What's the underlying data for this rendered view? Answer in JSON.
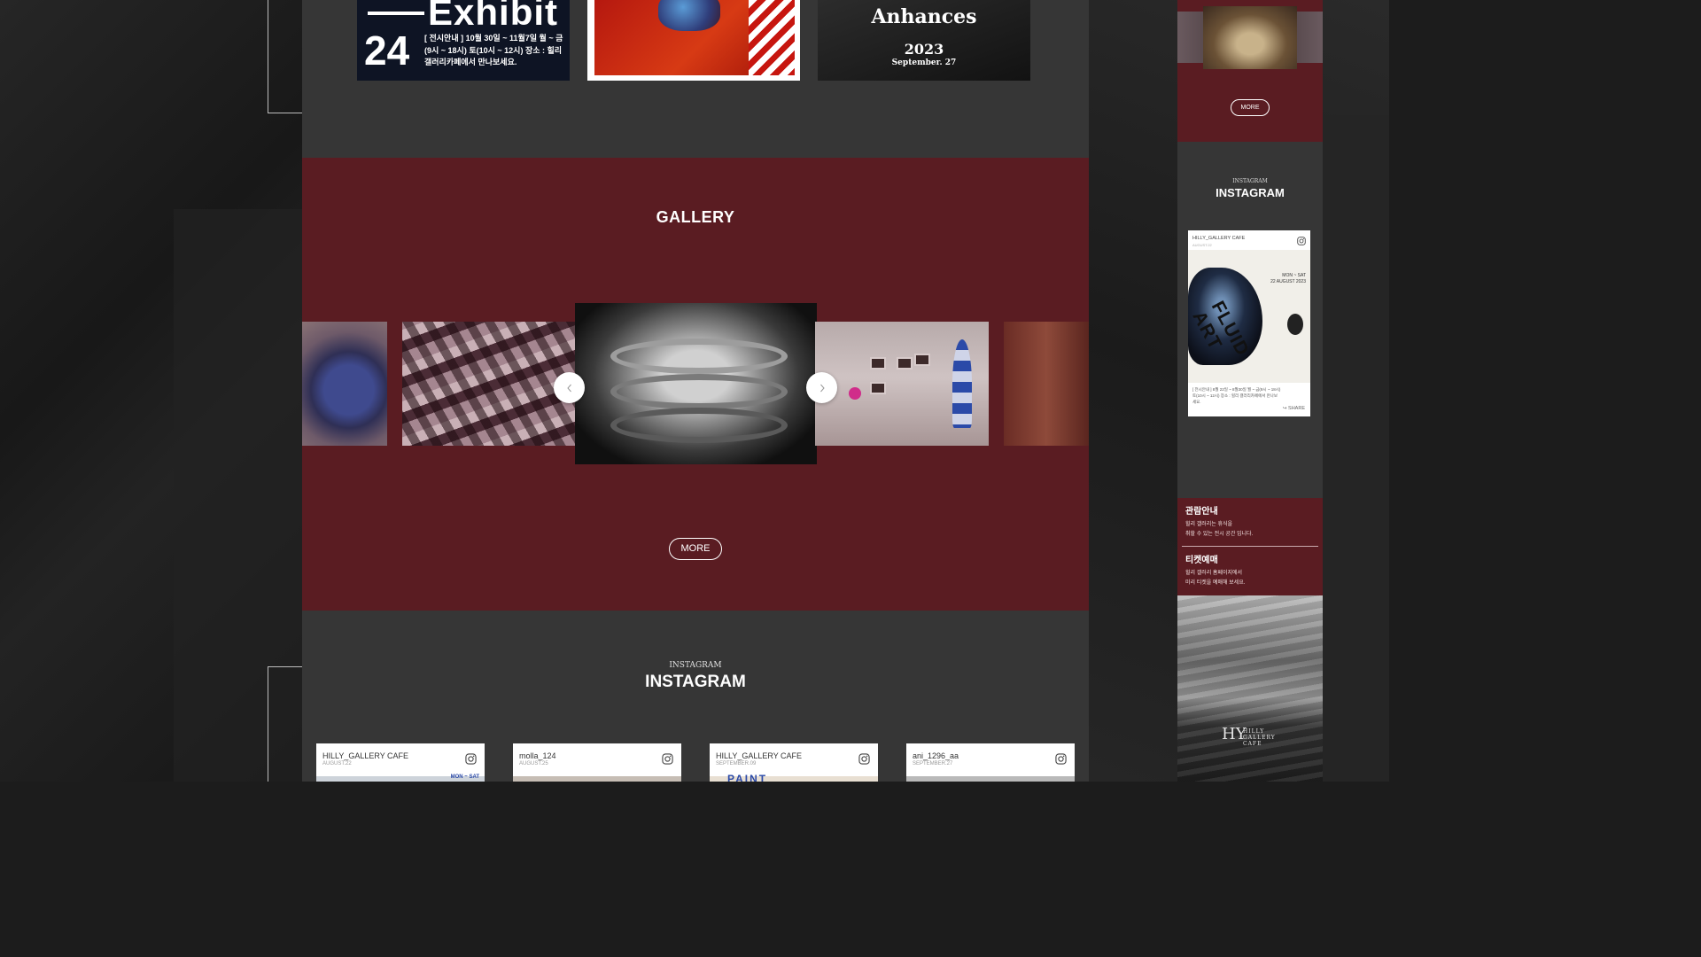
{
  "exhibit_cards": [
    {
      "word": "Exhibit",
      "number": "24",
      "info": "[ 전시안내 ] 10월 30일 ~ 11월7일 월 ~ 금(9시 ~ 18시) 토(10시 ~ 12시) 장소 : 힐리 갤러리카페에서 만나보세요."
    },
    {},
    {
      "title": "Anhances",
      "year": "2023",
      "date": "September. 27"
    }
  ],
  "gallery": {
    "title": "GALLERY",
    "more_label": "MORE",
    "prev_icon": "chevron-left-icon",
    "next_icon": "chevron-right-icon"
  },
  "instagram": {
    "small_label": "INSTAGRAM",
    "title": "INSTAGRAM",
    "posts": [
      {
        "user": "HILLY_GALLERY CAFE",
        "date": "AUGUST.22",
        "strip_text": "MON ~ SAT"
      },
      {
        "user": "molla_124",
        "date": "AUGUST.25",
        "strip_text": ""
      },
      {
        "user": "HILLY_GALLERY CAFE",
        "date": "SEPTEMBER.09",
        "strip_text": "PAINT"
      },
      {
        "user": "ani_1296_aa",
        "date": "SEPTEMBER.27",
        "strip_text": ""
      }
    ]
  },
  "sidebar": {
    "more_label": "MORE",
    "instagram_small": "INSTAGRAM",
    "instagram_title": "INSTAGRAM",
    "post": {
      "user": "HILLY_GALLERY CAFE",
      "date": "AUGUST.22",
      "tagline_1": "MON ~ SAT",
      "tagline_2": "22 AUGUST 2023",
      "art_word": "FLUID ART",
      "desc": "[ 전시안내 ] 8월 22일 ~ 8월30일 월 ~ 금(9시 ~ 18시) 토(10시 ~ 12시) 장소 : 힐리 갤러리카페에서 만나보세요.",
      "share": "SHARE"
    },
    "info": {
      "heading_1": "관람안내",
      "text_1a": "힐리 갤러리는 휴식을",
      "text_1b": "취할 수 있는 전시 공간 입니다.",
      "heading_2": "티켓예매",
      "text_2a": "힐리 갤러리 홈페이지에서",
      "text_2b": "미리 티켓을 예매해 보세요."
    },
    "logo_mark": "HY",
    "logo_line_1": "HILLY",
    "logo_line_2": "GALLERY",
    "logo_line_3": "CAFE"
  }
}
